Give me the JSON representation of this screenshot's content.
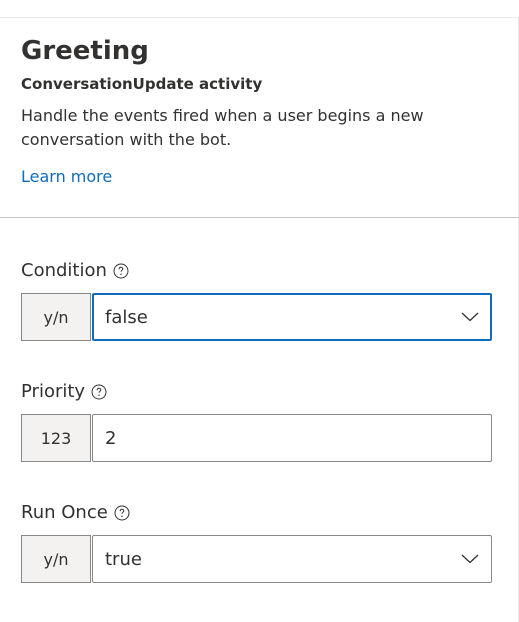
{
  "header": {
    "title": "Greeting",
    "subtitle": "ConversationUpdate activity",
    "description": "Handle the events fired when a user begins a new conversation with the bot.",
    "learn_more": "Learn more"
  },
  "fields": [
    {
      "label": "Condition",
      "type_tag": "y/n",
      "value": "false",
      "control": "dropdown",
      "help_icon": "question-circle-icon"
    },
    {
      "label": "Priority",
      "type_tag": "123",
      "value": "2",
      "control": "text-input",
      "help_icon": "question-circle-icon"
    },
    {
      "label": "Run Once",
      "type_tag": "y/n",
      "value": "true",
      "control": "dropdown",
      "help_icon": "question-circle-icon"
    }
  ],
  "colors": {
    "link": "#0f6cbd",
    "focus_border": "#0f6cbd",
    "tag_background": "#f3f2f1",
    "border": "#8a8886",
    "text": "#323130"
  }
}
